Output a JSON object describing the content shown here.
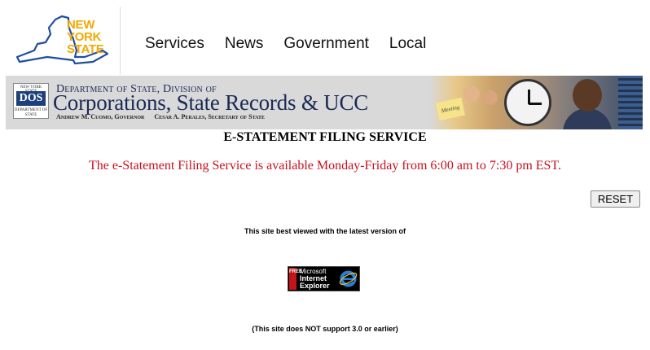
{
  "header": {
    "logo_lines": [
      "NEW",
      "YORK",
      "STATE"
    ],
    "nav": [
      {
        "label": "Services"
      },
      {
        "label": "News"
      },
      {
        "label": "Government"
      },
      {
        "label": "Local"
      }
    ]
  },
  "banner": {
    "seal_top": "NEW YORK STATE",
    "seal_mark": "DOS",
    "seal_bottom": "DEPARTMENT OF STATE",
    "line1": "Department of State, Division of",
    "line2": "Corporations, State Records & UCC",
    "governor": "Andrew M. Cuomo, Governor",
    "secretary": "Cesar A. Perales, Secretary of State",
    "note": "Meeting"
  },
  "main": {
    "title": "E-STATEMENT FILING SERVICE",
    "availability": "The e-Statement Filing Service is available Monday-Friday from 6:00 am to 7:30 pm EST.",
    "reset_label": "RESET",
    "best_viewed": "This site best viewed with the latest version of",
    "ie_badge": {
      "free": "FREE",
      "line1": "Microsoft",
      "line2": "Internet",
      "line3": "Explorer"
    },
    "not_support": "(This site does NOT support 3.0 or earlier)"
  },
  "colors": {
    "logo_gold": "#f2a900",
    "map_blue": "#1f4fa0",
    "banner_navy": "#1a2a55",
    "notice_red": "#c8101e"
  },
  "icons": [
    "ny-state-map-icon",
    "dos-seal-icon",
    "internet-explorer-icon"
  ]
}
